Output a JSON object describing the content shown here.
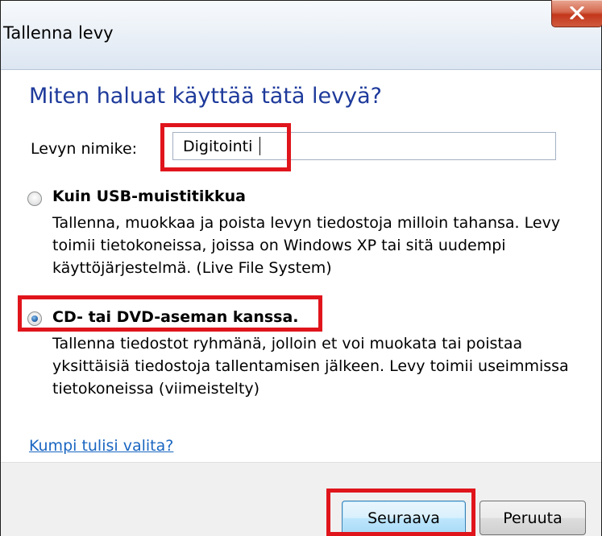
{
  "window": {
    "title": "Tallenna levy"
  },
  "heading": "Miten haluat käyttää tätä levyä?",
  "disc_name": {
    "label": "Levyn nimike:",
    "value": "Digitointi"
  },
  "options": [
    {
      "title": "Kuin USB-muistitikkua",
      "selected": false,
      "description": "Tallenna, muokkaa ja poista levyn tiedostoja milloin tahansa. Levy toimii tietokoneissa, joissa on Windows XP tai sitä uudempi käyttöjärjestelmä. (Live File System)"
    },
    {
      "title": "CD- tai DVD-aseman kanssa.",
      "selected": true,
      "description": "Tallenna tiedostot ryhmänä, jolloin et voi muokata tai poistaa yksittäisiä tiedostoja tallentamisen jälkeen. Levy toimii useimmissa tietokoneissa (viimeistelty)"
    }
  ],
  "help_link": "Kumpi tulisi valita?",
  "buttons": {
    "next": "Seuraava",
    "cancel": "Peruuta"
  },
  "colors": {
    "highlight": "#e0151c",
    "heading": "#1e3a9b",
    "link": "#1a66c1"
  },
  "icons": {
    "close": "close-icon"
  }
}
